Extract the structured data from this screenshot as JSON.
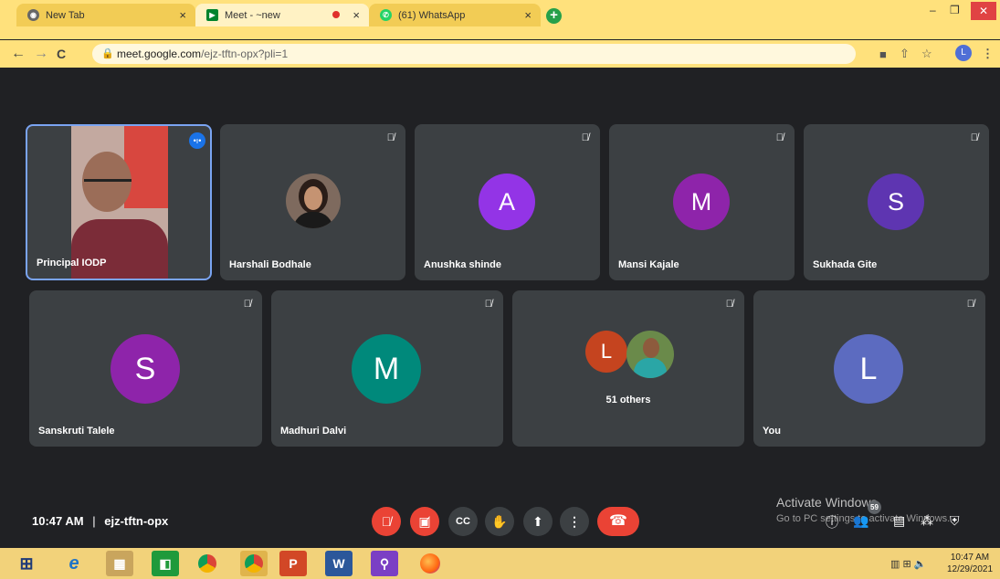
{
  "browser": {
    "tabs": [
      {
        "label": "New Tab"
      },
      {
        "label": "Meet - ~new"
      },
      {
        "label": "(61) WhatsApp"
      }
    ],
    "tab_close": "×",
    "new_tab": "+",
    "url_host": "meet.google.com",
    "url_path": "/ejz-tftn-opx?pli=1",
    "profile_initial": "L",
    "window_min": "–",
    "window_max": "❐",
    "window_close": "✕"
  },
  "participants": [
    {
      "name": "Principal IODP",
      "type": "video",
      "speaking": true
    },
    {
      "name": "Harshali Bodhale",
      "type": "photo",
      "muted": true
    },
    {
      "name": "Anushka shinde",
      "initial": "A",
      "color": "#9334e6",
      "muted": true
    },
    {
      "name": "Mansi Kajale",
      "initial": "M",
      "color": "#8e24aa",
      "muted": true
    },
    {
      "name": "Sukhada Gite",
      "initial": "S",
      "color": "#5e35b1",
      "muted": true
    },
    {
      "name": "Sanskruti Talele",
      "initial": "S",
      "color": "#8e24aa",
      "muted": true
    },
    {
      "name": "Madhuri Dalvi",
      "initial": "M",
      "color": "#00897b",
      "muted": true
    },
    {
      "name": "51 others",
      "initial": "L",
      "color": "#c5441f",
      "muted": true
    },
    {
      "name": "You",
      "initial": "L",
      "color": "#5c6bc0",
      "muted": true
    }
  ],
  "meeting": {
    "time": "10:47 AM",
    "separator": "|",
    "code": "ejz-tftn-opx",
    "people_count": "59"
  },
  "activation": {
    "title": "Activate Windows",
    "subtitle": "Go to PC settings to activate Windows."
  },
  "taskbar": {
    "time": "10:47 AM",
    "date": "12/29/2021"
  },
  "colors": {
    "meet_bg": "#202124",
    "tile_bg": "#3c4043",
    "danger": "#ea4335",
    "chrome_theme": "#ffe17c"
  }
}
